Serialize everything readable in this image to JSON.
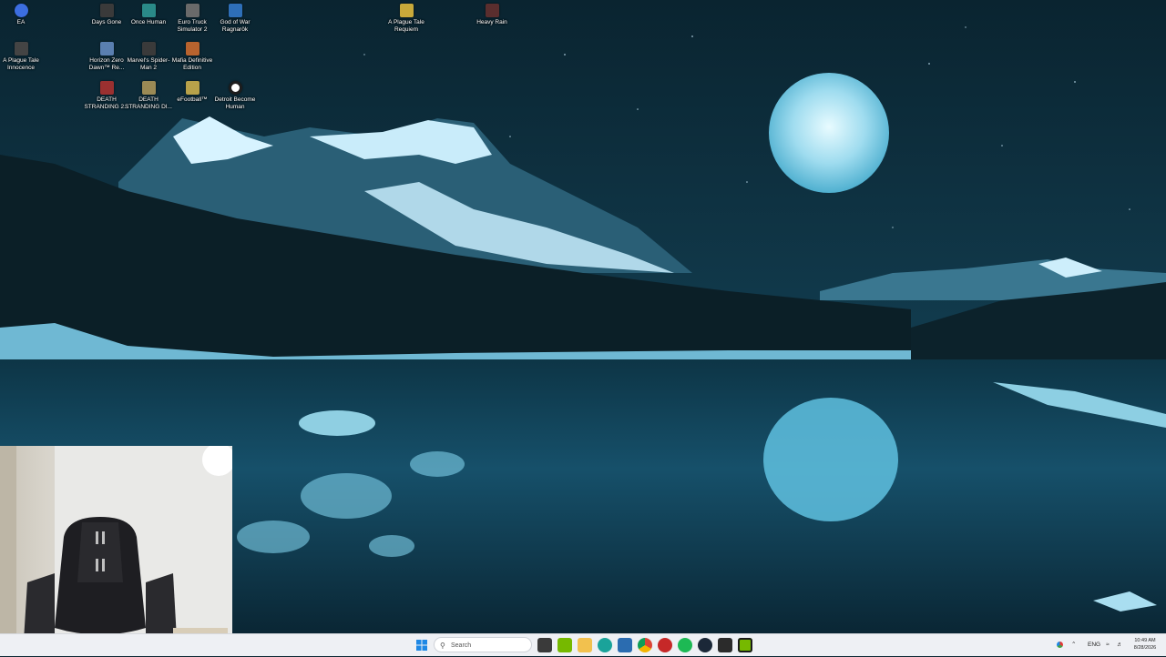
{
  "desktop": {
    "icons": [
      {
        "label": "EA",
        "color": "#3c6ee0"
      },
      {
        "label": "Days Gone",
        "color": "#3a3a3a"
      },
      {
        "label": "Once Human",
        "color": "#2a8a88"
      },
      {
        "label": "Euro Truck Simulator 2",
        "color": "#6a6a6a"
      },
      {
        "label": "God of War Ragnarök",
        "color": "#2e6fb8"
      },
      {
        "label": "A Plague Tale Requiem",
        "color": "#c8a93a"
      },
      {
        "label": "Heavy Rain",
        "color": "#5a2e2e"
      },
      {
        "label": "A Plague Tale Innocence",
        "color": "#444"
      },
      {
        "label": "Horizon Zero Dawn™ Re...",
        "color": "#5a7fb0"
      },
      {
        "label": "Marvel's Spider-Man 2",
        "color": "#3a3a3a"
      },
      {
        "label": "Mafia Definitive Edition",
        "color": "#b8632e"
      },
      {
        "label": "DEATH STRANDING 2...",
        "color": "#9a3030"
      },
      {
        "label": "DEATH STRANDING DI...",
        "color": "#9b8a55"
      },
      {
        "label": "eFootball™",
        "color": "#b8a24a"
      },
      {
        "label": "Detroit Become Human",
        "color": "#1d1d1d"
      }
    ]
  },
  "taskbar": {
    "search_placeholder": "Search",
    "pinned": [
      {
        "name": "start-icon",
        "color": "#1e88e5"
      },
      {
        "name": "task-view-icon",
        "color": "#3a3a3a"
      },
      {
        "name": "nvidia-icon",
        "color": "#76b900"
      },
      {
        "name": "file-explorer-icon",
        "color": "#f2c14e"
      },
      {
        "name": "edge-icon",
        "color": "#1aa39a"
      },
      {
        "name": "store-icon",
        "color": "#2b6cb0"
      },
      {
        "name": "chrome-icon",
        "color": "#db4437"
      },
      {
        "name": "app-red-icon",
        "color": "#c62828"
      },
      {
        "name": "spotify-icon",
        "color": "#1db954"
      },
      {
        "name": "steam-icon",
        "color": "#1b2838"
      },
      {
        "name": "app-dark-icon",
        "color": "#2b2b2b"
      },
      {
        "name": "terminal-green-icon",
        "color": "#76b900"
      }
    ],
    "tray": {
      "language": "ENG",
      "time": "10:49 AM",
      "date": "8/28/2026"
    }
  }
}
